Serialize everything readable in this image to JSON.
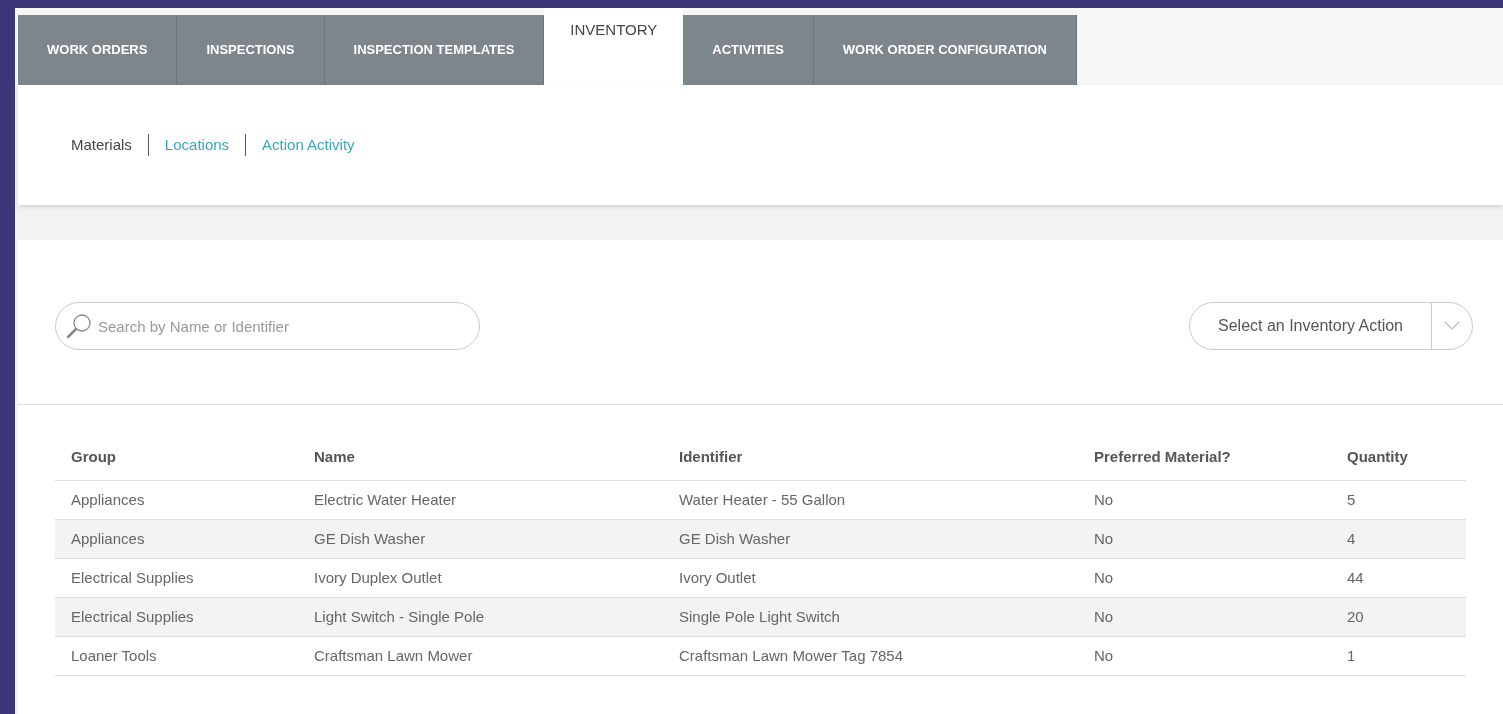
{
  "tabs": [
    {
      "label": "WORK ORDERS",
      "selected": false
    },
    {
      "label": "INSPECTIONS",
      "selected": false
    },
    {
      "label": "INSPECTION TEMPLATES",
      "selected": false
    },
    {
      "label": "INVENTORY",
      "selected": true
    },
    {
      "label": "ACTIVITIES",
      "selected": false
    },
    {
      "label": "WORK ORDER CONFIGURATION",
      "selected": false
    }
  ],
  "subnav": [
    {
      "label": "Materials",
      "selected": true
    },
    {
      "label": "Locations",
      "selected": false
    },
    {
      "label": "Action Activity",
      "selected": false
    }
  ],
  "search": {
    "placeholder": "Search by Name or Identifier"
  },
  "action_select": {
    "value": "Select an Inventory Action"
  },
  "table": {
    "columns": [
      "Group",
      "Name",
      "Identifier",
      "Preferred Material?",
      "Quantity"
    ],
    "rows": [
      [
        "Appliances",
        "Electric Water Heater",
        "Water Heater - 55 Gallon",
        "No",
        "5"
      ],
      [
        "Appliances",
        "GE Dish Washer",
        "GE Dish Washer",
        "No",
        "4"
      ],
      [
        "Electrical Supplies",
        "Ivory Duplex Outlet",
        "Ivory Outlet",
        "No",
        "44"
      ],
      [
        "Electrical Supplies",
        "Light Switch - Single Pole",
        "Single Pole Light Switch",
        "No",
        "20"
      ],
      [
        "Loaner Tools",
        "Craftsman Lawn Mower",
        "Craftsman Lawn Mower Tag 7854",
        "No",
        "1"
      ]
    ]
  }
}
